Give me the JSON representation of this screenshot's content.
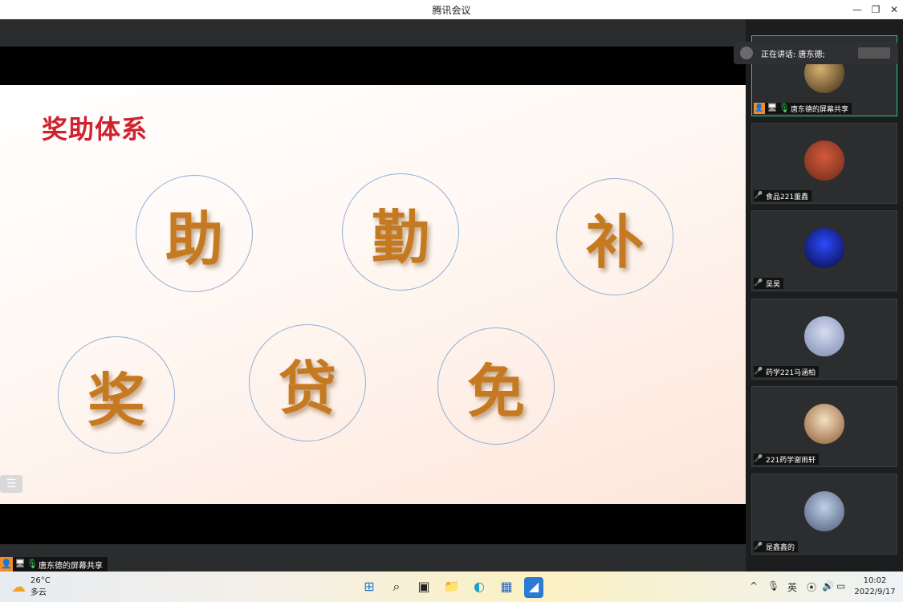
{
  "window": {
    "title": "腾讯会议",
    "min": "—",
    "restore": "❐",
    "close": "✕"
  },
  "slide": {
    "title": "奖助体系",
    "chars": [
      "助",
      "勤",
      "补",
      "奖",
      "贷",
      "免"
    ]
  },
  "share_label": "唐东德的屏幕共享",
  "speaker": {
    "text": "正在讲话: 唐东德;"
  },
  "participants": [
    {
      "name": "唐东德的屏幕共享",
      "active": true,
      "avatar_color": "#7a5a2a"
    },
    {
      "name": "食品221董鑫",
      "active": false,
      "avatar_color": "#b23a2a"
    },
    {
      "name": "吴昊",
      "active": false,
      "avatar_color": "#1b3cff"
    },
    {
      "name": "药学221马涵柏",
      "active": false,
      "avatar_color": "#b8c0d8"
    },
    {
      "name": "221药学谢雨轩",
      "active": false,
      "avatar_color": "#d9a36a"
    },
    {
      "name": "是鑫鑫的",
      "active": false,
      "avatar_color": "#8aa0c0"
    }
  ],
  "taskbar": {
    "weather_temp": "26°C",
    "weather_desc": "多云",
    "ime": "英",
    "time": "10:02",
    "date": "2022/9/17"
  },
  "icons": {
    "person": "👤",
    "screen": "🖥",
    "mic": "🎙",
    "mute": "🎤",
    "list": "☰",
    "start": "⊞",
    "search": "⌕",
    "taskview": "▣",
    "explorer": "📁",
    "edge": "◐",
    "store": "▦",
    "meeting": "◢",
    "chev": "^",
    "tray_mic": "🎙",
    "wifi": "⦿",
    "vol": "🔊",
    "batt": "▭",
    "weather": "☁"
  }
}
